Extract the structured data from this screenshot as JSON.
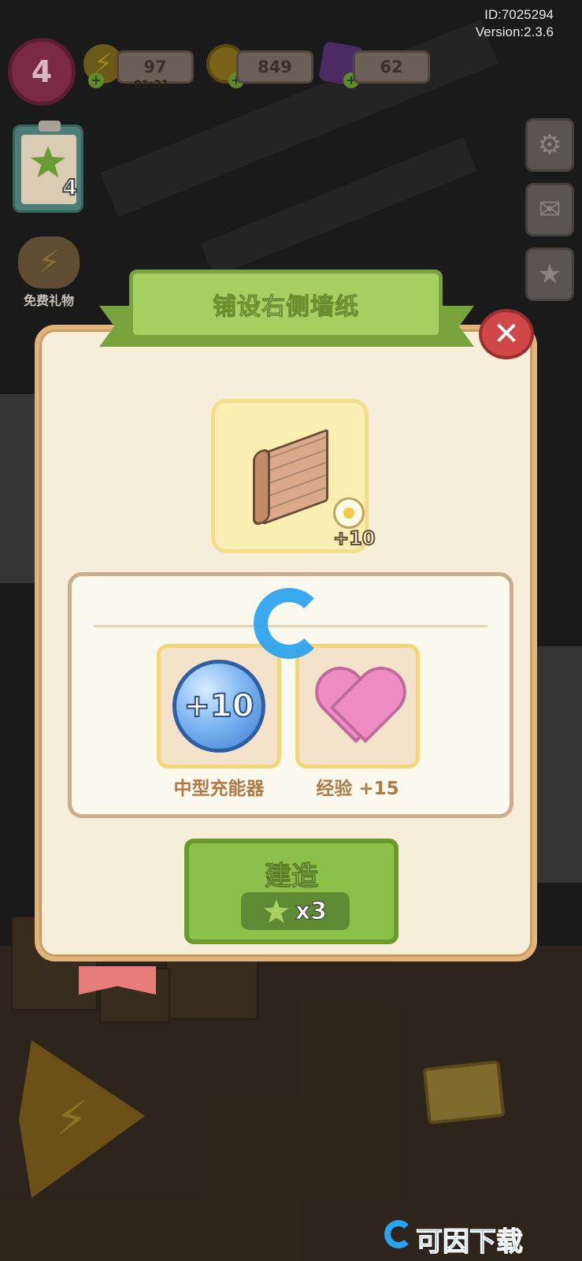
{
  "hud": {
    "id_text": "ID:7025294",
    "version_text": "Version:2.3.6",
    "level": "4",
    "energy": "97",
    "energy_timer": "01:31",
    "coins": "849",
    "gems": "62",
    "quest_count": "4",
    "free_gift_label": "免费礼物"
  },
  "dialog": {
    "title": "铺设右侧墙纸",
    "close_symbol": "✕",
    "item_bonus": "+10",
    "rewards": [
      {
        "orb_text": "+10",
        "label": "中型充能器"
      },
      {
        "label": "经验 +15"
      }
    ],
    "build_label": "建造",
    "cost_qty": "x3"
  },
  "watermark": {
    "text": "可因下载"
  },
  "colors": {
    "accent_green": "#8dc04a",
    "close_red": "#d04747",
    "reward_text": "#b07a45",
    "watermark_blue": "#2aa3f0"
  }
}
